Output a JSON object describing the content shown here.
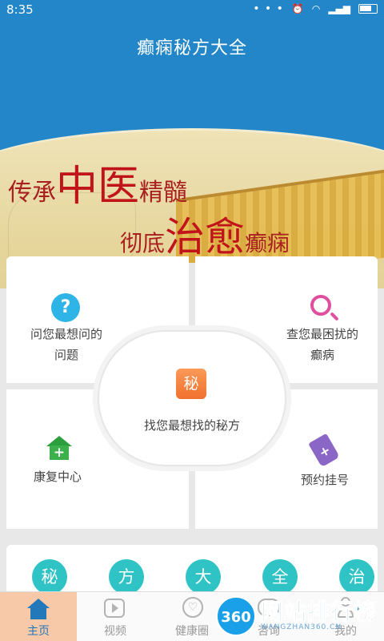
{
  "status_bar": {
    "time": "8:35",
    "dots": "• • •"
  },
  "header": {
    "title": "癫痫秘方大全"
  },
  "banner": {
    "line1_a": "传承",
    "line1_big": "中医",
    "line1_b": "精髓",
    "line2_a": "彻底",
    "line2_big": "治愈",
    "line2_b": "癫痫"
  },
  "cards": {
    "ask": {
      "label_line1": "问您最想问的",
      "label_line2": "问题",
      "icon_glyph": "?"
    },
    "search": {
      "label_line1": "查您最困扰的",
      "label_line2": "癫病"
    },
    "find": {
      "icon_glyph": "秘",
      "label": "找您最想找的秘方"
    },
    "rehab": {
      "icon_glyph": "+",
      "label": "康复中心"
    },
    "register": {
      "icon_glyph": "+",
      "label": "预约挂号"
    }
  },
  "recommend": {
    "chars": [
      "秘",
      "方",
      "大",
      "全",
      "治"
    ]
  },
  "tabs": [
    {
      "label": "主页",
      "icon": "home-icon",
      "active": true
    },
    {
      "label": "视频",
      "icon": "video-icon",
      "active": false
    },
    {
      "label": "健康圈",
      "icon": "heart-icon",
      "active": false
    },
    {
      "label": "咨询",
      "icon": "chat-icon",
      "active": false
    },
    {
      "label": "我的",
      "icon": "user-icon",
      "active": false
    }
  ],
  "watermark": {
    "badge": "360",
    "text": "网站排行榜",
    "sub": "WANGZHAN360.CN"
  },
  "colors": {
    "primary": "#2386c8",
    "accent_circle": "#2fc3c6",
    "orange": "#f0702e",
    "green": "#3cb04a",
    "purple": "#8a66c6",
    "pink": "#e04e9e"
  }
}
